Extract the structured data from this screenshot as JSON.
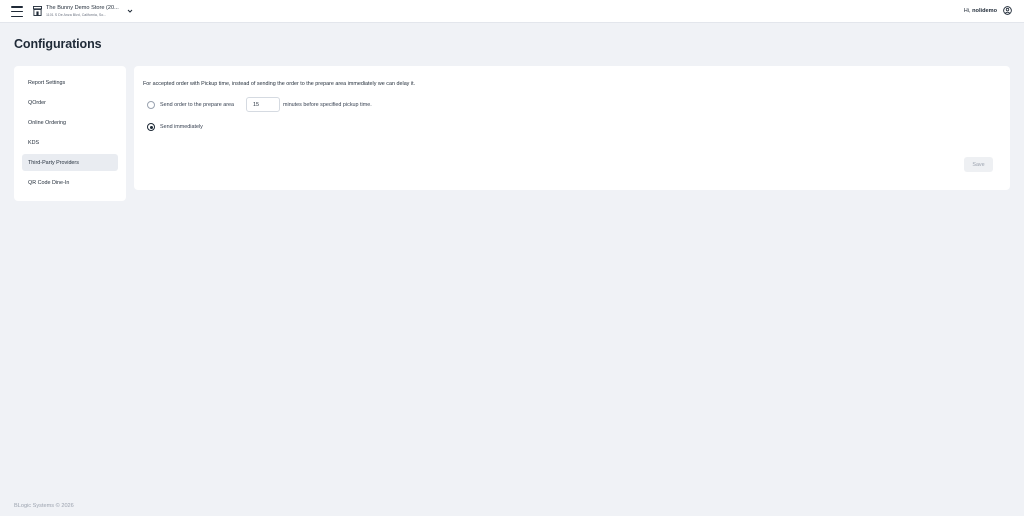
{
  "header": {
    "menu_icon": "hamburger-menu-icon",
    "store_icon": "store-icon",
    "store_name": "The Bunny Demo Store (20...",
    "store_address": "1101 S De Anza Blvd, California, So...",
    "greeting_prefix": "Hi,",
    "username": "nolidemo",
    "user_icon": "user-circle-icon"
  },
  "page_title": "Configurations",
  "sidebar": {
    "items": [
      {
        "label": "Report Settings",
        "active": false
      },
      {
        "label": "QOrder",
        "active": false
      },
      {
        "label": "Online Ordering",
        "active": false
      },
      {
        "label": "KDS",
        "active": false
      },
      {
        "label": "Third-Party Providers",
        "active": true
      },
      {
        "label": "QR Code Dine-In",
        "active": false
      }
    ]
  },
  "panel": {
    "description": "For accepted order with Pickup time, instead of sending the order to the prepare area immediately we can delay it.",
    "option_delay": {
      "label_before": "Send order to the prepare area",
      "minutes_value": "15",
      "label_after": "minutes before specified pickup time.",
      "checked": false
    },
    "option_immediate": {
      "label": "Send immediately",
      "checked": true
    },
    "save_label": "Save"
  },
  "footer": "BLogic Systems © 2026"
}
